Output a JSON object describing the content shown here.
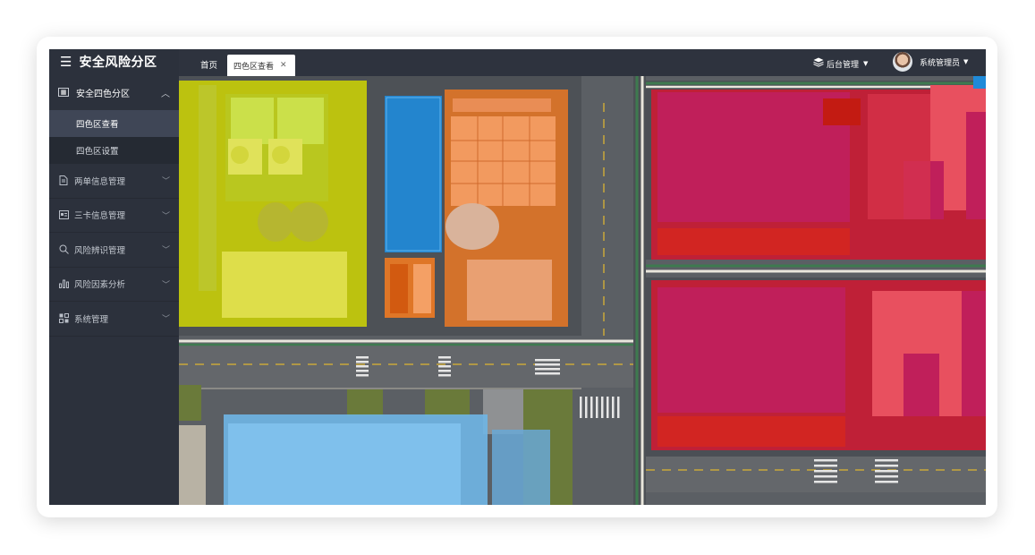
{
  "app": {
    "title": "安全风险分区"
  },
  "sidebar": {
    "group": {
      "label": "安全四色分区",
      "icon": "grid-icon"
    },
    "subitems": [
      {
        "label": "四色区查看",
        "active": true
      },
      {
        "label": "四色区设置",
        "active": false
      }
    ],
    "items": [
      {
        "label": "两单信息管理",
        "icon": "document-icon"
      },
      {
        "label": "三卡信息管理",
        "icon": "id-card-icon"
      },
      {
        "label": "风险辨识管理",
        "icon": "search-icon"
      },
      {
        "label": "风险因素分析",
        "icon": "bar-chart-icon"
      },
      {
        "label": "系统管理",
        "icon": "settings-icon"
      }
    ]
  },
  "topbar": {
    "tabs": [
      {
        "label": "首页"
      },
      {
        "label": "四色区查看",
        "closable": true
      }
    ],
    "admin_label": "后台管理",
    "user_label": "系统管理员"
  },
  "map": {
    "zone_colors": {
      "yellow": "#d4dc00",
      "orange": "#f07a22",
      "blue": "#1f8ad8",
      "light_blue": "#6fb6e6",
      "red": "#e0132f",
      "crimson": "#c01f5a"
    }
  }
}
